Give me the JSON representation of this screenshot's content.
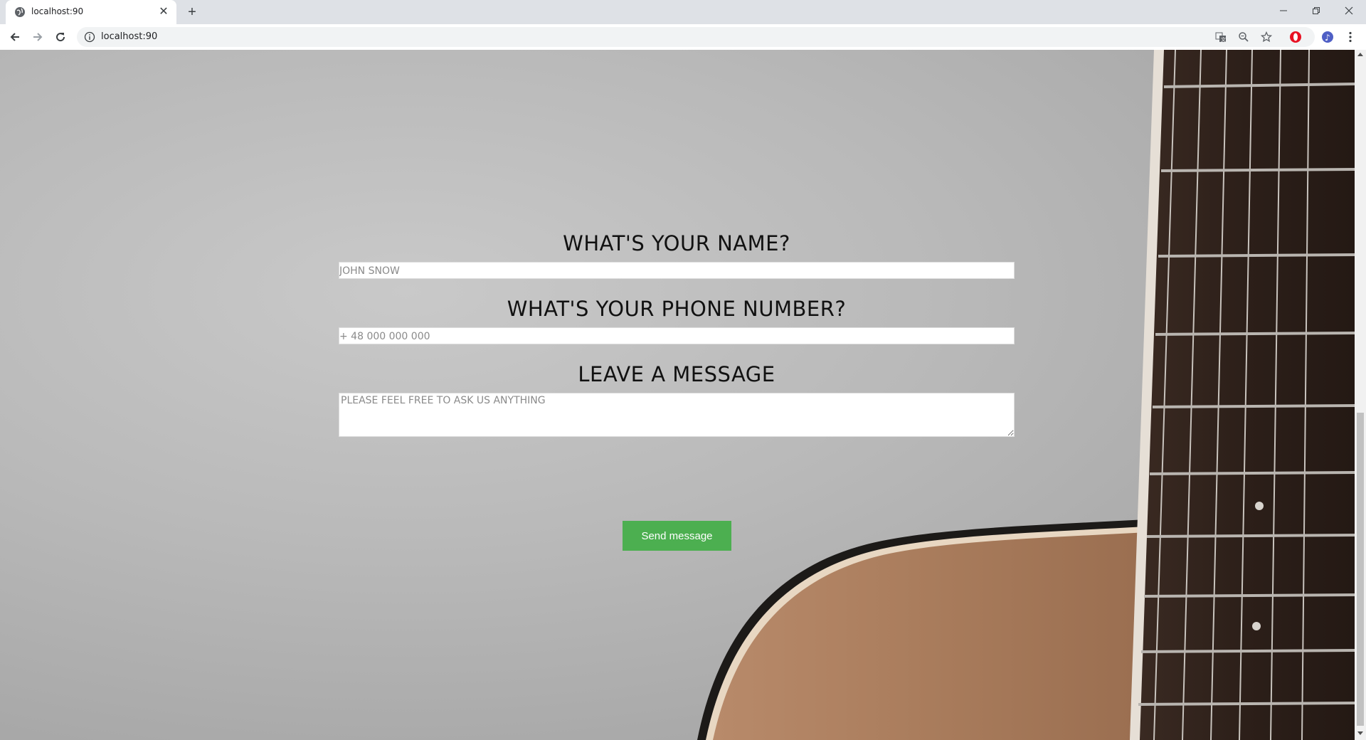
{
  "browser": {
    "tab_title": "localhost:90",
    "tab_close": "✕",
    "new_tab": "+",
    "url": "localhost:90",
    "window_controls": {
      "minimize": "—",
      "restore": "❐",
      "close": "✕"
    }
  },
  "form": {
    "name_heading": "WHAT'S YOUR NAME?",
    "name_placeholder": "JOHN SNOW",
    "phone_heading": "WHAT'S YOUR PHONE NUMBER?",
    "phone_placeholder": "+ 48 000 000 000",
    "message_heading": "LEAVE A MESSAGE",
    "message_placeholder": "PLEASE FEEL FREE TO ASK US ANYTHING",
    "send_label": "Send message"
  },
  "colors": {
    "button": "#4caf50",
    "background": "#b9b9b9"
  },
  "icons": [
    "globe-icon",
    "close-icon",
    "plus-icon",
    "back-icon",
    "forward-icon",
    "reload-icon",
    "info-icon",
    "translate-icon",
    "zoom-icon",
    "star-icon",
    "opera-icon",
    "music-icon",
    "menu-icon"
  ]
}
